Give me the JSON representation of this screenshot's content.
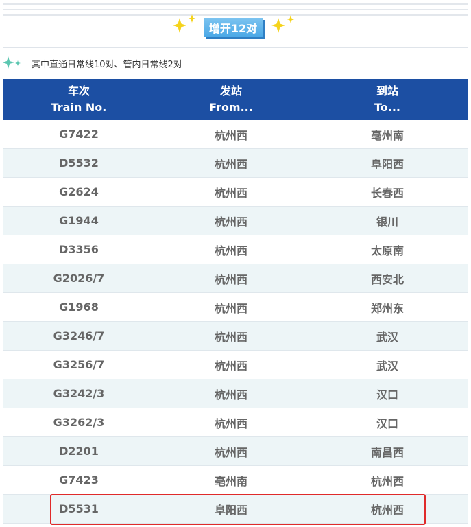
{
  "header": {
    "badge_label": "增开12对"
  },
  "notice": {
    "text": "其中直通日常线10对、管内日常线2对"
  },
  "table": {
    "columns": [
      {
        "zh": "车次",
        "en": "Train No."
      },
      {
        "zh": "发站",
        "en": "From..."
      },
      {
        "zh": "到站",
        "en": "To..."
      }
    ],
    "rows": [
      {
        "train": "G7422",
        "from": "杭州西",
        "to": "亳州南"
      },
      {
        "train": "D5532",
        "from": "杭州西",
        "to": "阜阳西"
      },
      {
        "train": "G2624",
        "from": "杭州西",
        "to": "长春西"
      },
      {
        "train": "G1944",
        "from": "杭州西",
        "to": "银川"
      },
      {
        "train": "D3356",
        "from": "杭州西",
        "to": "太原南"
      },
      {
        "train": "G2026/7",
        "from": "杭州西",
        "to": "西安北"
      },
      {
        "train": "G1968",
        "from": "杭州西",
        "to": "郑州东"
      },
      {
        "train": "G3246/7",
        "from": "杭州西",
        "to": "武汉"
      },
      {
        "train": "G3256/7",
        "from": "杭州西",
        "to": "武汉"
      },
      {
        "train": "G3242/3",
        "from": "杭州西",
        "to": "汉口"
      },
      {
        "train": "G3262/3",
        "from": "杭州西",
        "to": "汉口"
      },
      {
        "train": "D2201",
        "from": "杭州西",
        "to": "南昌西"
      },
      {
        "train": "G7423",
        "from": "亳州南",
        "to": "杭州西"
      },
      {
        "train": "D5531",
        "from": "阜阳西",
        "to": "杭州西"
      }
    ]
  },
  "colors": {
    "header_bg": "#1c4fa3",
    "badge_bg": "#4aa8e6",
    "highlight_border": "#e02a2a",
    "row_alt_bg": "#edf5f7",
    "sparkle": "#f5d31c"
  },
  "icons": {
    "sparkle": "sparkle-icon",
    "notice": "sparkle-notice-icon"
  }
}
